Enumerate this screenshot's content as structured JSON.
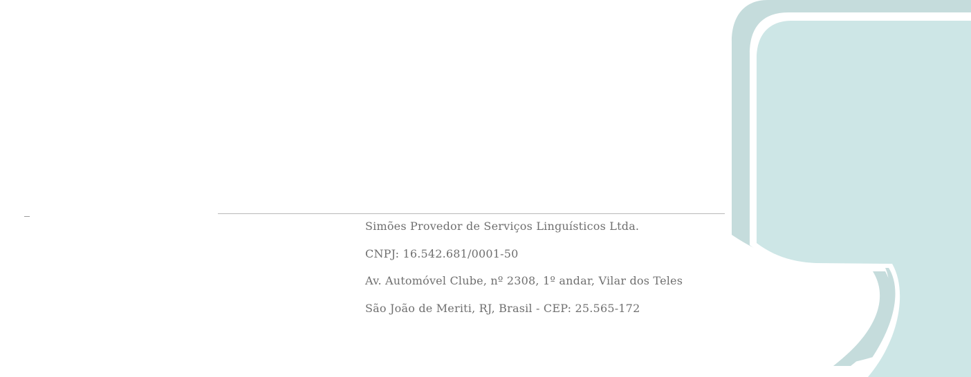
{
  "footer": {
    "company": "Simões Provedor de Serviços Linguísticos Ltda.",
    "cnpj": "CNPJ: 16.542.681/0001-50",
    "address": "Av. Automóvel Clube, nº 2308, 1º andar, Vilar dos Teles",
    "city": "São João de Meriti, RJ, Brasil - CEP: 25.565-172"
  },
  "decoration": {
    "logo": "speech-bubble-logo",
    "colors": {
      "bubble_dark": "#c5dcdc",
      "bubble_light": "#cde6e6",
      "text": "#6f6f6f",
      "rule": "#b8b8b8"
    }
  }
}
